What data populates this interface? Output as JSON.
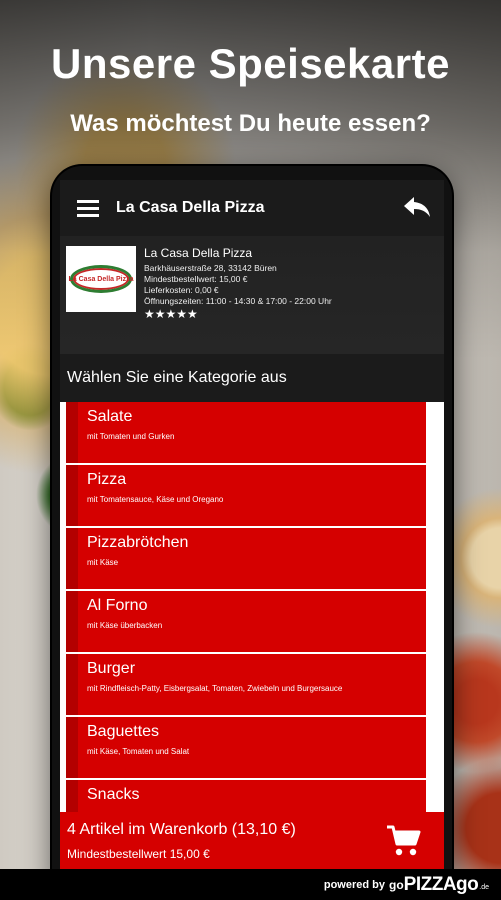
{
  "promo": {
    "headline": "Unsere Speisekarte",
    "subline": "Was möchtest Du heute essen?"
  },
  "appbar": {
    "title": "La Casa Della Pizza",
    "menu_icon": "hamburger-icon",
    "back_icon": "reply-arrow-icon"
  },
  "restaurant": {
    "logo_text": "La Casa Della Pizza",
    "name": "La Casa Della Pizza",
    "address": "Barkhäuserstraße 28, 33142 Büren",
    "min_order": "Mindestbestellwert: 15,00 €",
    "delivery_cost": "Lieferkosten: 0,00 €",
    "opening_hours": "Öffnungszeiten: 11:00 - 14:30 & 17:00 - 22:00 Uhr",
    "stars": "★★★★★",
    "rating": 5
  },
  "category_prompt": "Wählen Sie eine Kategorie aus",
  "categories": [
    {
      "title": "Salate",
      "description": "mit Tomaten und Gurken"
    },
    {
      "title": "Pizza",
      "description": "mit Tomatensauce, Käse und Oregano"
    },
    {
      "title": "Pizzabrötchen",
      "description": "mit Käse"
    },
    {
      "title": "Al Forno",
      "description": "mit Käse überbacken"
    },
    {
      "title": "Burger",
      "description": "mit Rindfleisch-Patty, Eisbergsalat, Tomaten, Zwiebeln und Burgersauce"
    },
    {
      "title": "Baguettes",
      "description": "mit Käse, Tomaten und Salat"
    },
    {
      "title": "Snacks",
      "description": ""
    }
  ],
  "cart": {
    "summary": "4 Artikel im Warenkorb (13,10 €)",
    "min_order": "Mindestbestellwert 15,00 €",
    "icon": "shopping-cart-icon"
  },
  "footer": {
    "powered_by": "powered by",
    "go": "go",
    "brand": "PIZZAgo",
    "tld": ".de"
  },
  "colors": {
    "accent_red": "#d50000",
    "dark_bar": "#1b1b1b"
  }
}
